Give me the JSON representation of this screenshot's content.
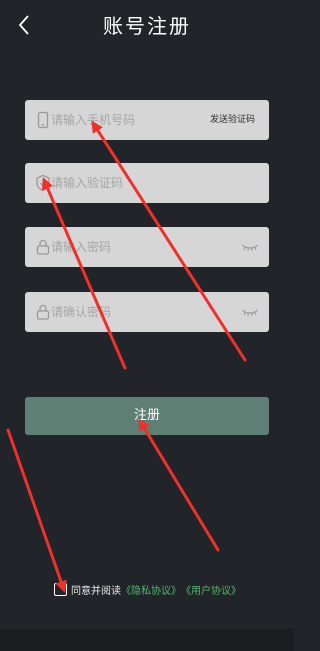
{
  "header": {
    "title": "账号注册",
    "back_icon": "chevron-left-icon"
  },
  "form": {
    "phone": {
      "placeholder": "请输入手机号码",
      "icon": "phone-icon"
    },
    "send_code_label": "发送验证码",
    "code": {
      "placeholder": "请输入验证码",
      "icon": "shield-icon"
    },
    "password": {
      "placeholder": "请输入密码",
      "icon": "lock-icon",
      "eye_icon": "eye-closed-icon"
    },
    "confirm_password": {
      "placeholder": "请确认密码",
      "icon": "lock-icon",
      "eye_icon": "eye-closed-icon"
    },
    "register_label": "注册"
  },
  "agreement": {
    "prefix": "同意并阅读",
    "privacy": "《隐私协议》",
    "user": "《用户协议》",
    "checked": false
  },
  "colors": {
    "background": "#212429",
    "field": "#d6d6d6",
    "button": "#5f7f75",
    "link": "#52b96a",
    "annotation": "#f0302a"
  }
}
